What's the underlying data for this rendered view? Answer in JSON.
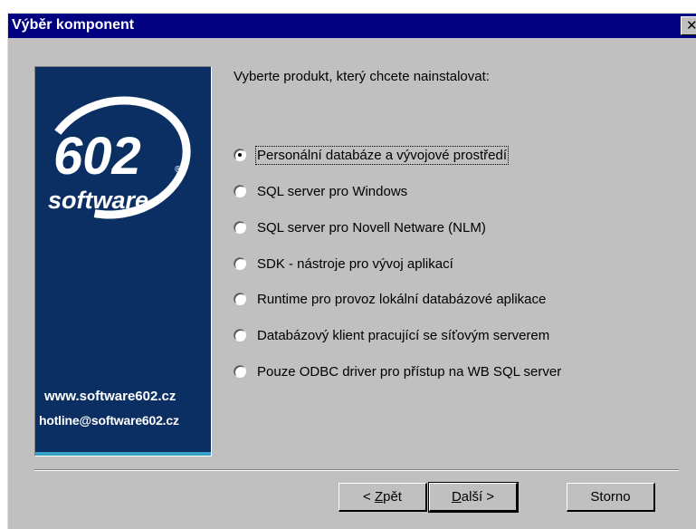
{
  "window": {
    "title": "Výběr komponent",
    "close_glyph": "✕"
  },
  "banner": {
    "logo_number": "602",
    "logo_registered": "®",
    "logo_word": "software",
    "web": "www.software602.cz",
    "hotline": "hotline@software602.cz",
    "colors": {
      "background": "#0b2f63",
      "strip": "#3aa0c8"
    }
  },
  "prompt": "Vyberte produkt, který chcete nainstalovat:",
  "options": [
    {
      "label": "Personální databáze a vývojové prostředí",
      "checked": true
    },
    {
      "label": "SQL server pro Windows",
      "checked": false
    },
    {
      "label": "SQL server pro Novell Netware (NLM)",
      "checked": false
    },
    {
      "label": "SDK - nástroje pro vývoj aplikací",
      "checked": false
    },
    {
      "label": "Runtime pro provoz lokální databázové aplikace",
      "checked": false
    },
    {
      "label": "Databázový klient pracující se síťovým serverem",
      "checked": false
    },
    {
      "label": "Pouze ODBC driver pro přístup na WB SQL server",
      "checked": false
    }
  ],
  "buttons": {
    "back": {
      "prefix": "< ",
      "underlined": "Z",
      "rest": "pět"
    },
    "next": {
      "underlined": "D",
      "rest": "alší >"
    },
    "cancel": "Storno"
  }
}
